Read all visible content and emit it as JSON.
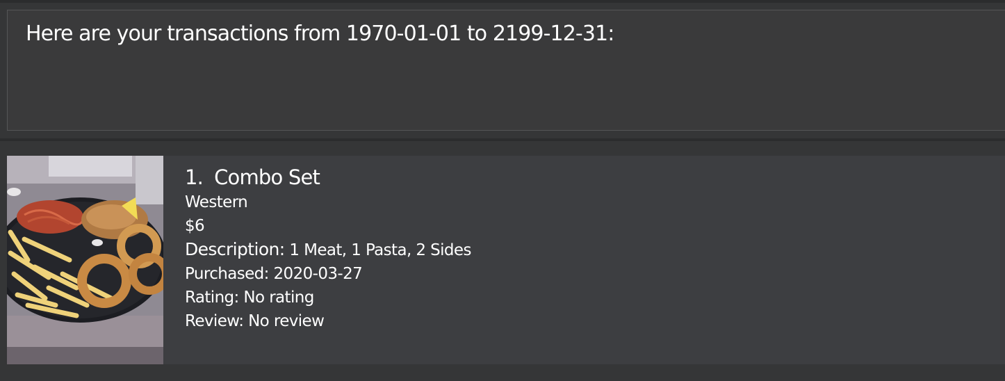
{
  "result": {
    "message": "Here are your transactions from 1970-01-01 to 2199-12-31:"
  },
  "transactions": [
    {
      "index": "1.",
      "name": "Combo Set",
      "category": "Western",
      "price": "$6",
      "description_label": "Description:",
      "description": "1 Meat, 1 Pasta, 2 Sides",
      "purchased": "Purchased: 2020-03-27",
      "rating": "Rating: No rating",
      "review": "Review: No review",
      "image_icon": "food-photo"
    }
  ],
  "colors": {
    "background": "#353637",
    "panel": "#3a3a3b",
    "card": "#3d3e41",
    "text": "#ffffff"
  }
}
